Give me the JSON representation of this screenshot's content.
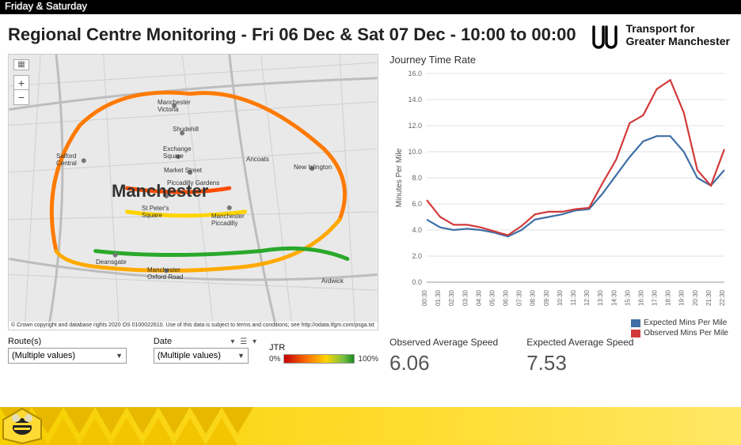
{
  "topbar": {
    "label": "Friday & Saturday"
  },
  "header": {
    "title": "Regional Centre Monitoring - Fri 06 Dec & Sat 07 Dec - 10:00 to 00:00",
    "logo_line1": "Transport for",
    "logo_line2": "Greater Manchester"
  },
  "map": {
    "city_label": "Manchester",
    "places": [
      "Manchester Victoria",
      "Shudehill",
      "Exchange Square",
      "Market Street",
      "Piccadilly Gardens",
      "St Peter's Square",
      "Deansgate",
      "Manchester Oxford Road",
      "Manchester Piccadilly",
      "New Islington",
      "Ancoats",
      "Salford Central",
      "Ardwick"
    ],
    "credit": "© Crown copyright and database rights 2020 OS 0100022610. Use of this data is subject to terms and conditions; see http://odata.tfgm.com/psga.txt"
  },
  "filters": {
    "routes": {
      "label": "Route(s)",
      "value": "(Multiple values)"
    },
    "date": {
      "label": "Date",
      "value": "(Multiple values)"
    },
    "jtr": {
      "label": "JTR",
      "min": "0%",
      "max": "100%"
    }
  },
  "chart": {
    "title": "Journey Time Rate",
    "ylabel": "Minutes Per Mile",
    "legend": {
      "expected": "Expected Mins Per Mile",
      "observed": "Observed Mins Per Mile"
    }
  },
  "stats": {
    "observed": {
      "label": "Observed Average Speed",
      "value": "6.06"
    },
    "expected": {
      "label": "Expected Average Speed",
      "value": "7.53"
    }
  },
  "chart_data": {
    "type": "line",
    "xlabel": "",
    "ylabel": "Minutes Per Mile",
    "ylim": [
      0,
      16
    ],
    "categories": [
      "00:30",
      "01:30",
      "02:30",
      "03:30",
      "04:30",
      "05:30",
      "06:30",
      "07:30",
      "08:30",
      "09:30",
      "10:30",
      "11:30",
      "12:30",
      "13:30",
      "14:30",
      "15:30",
      "16:30",
      "17:30",
      "18:30",
      "19:30",
      "20:30",
      "21:30",
      "22:30"
    ],
    "series": [
      {
        "name": "Expected Mins Per Mile",
        "color": "#3f6fa6",
        "values": [
          4.8,
          4.2,
          4.0,
          4.1,
          4.0,
          3.8,
          3.5,
          4.0,
          4.8,
          5.0,
          5.2,
          5.5,
          5.6,
          6.8,
          8.2,
          9.6,
          10.8,
          11.2,
          11.2,
          10.0,
          8.0,
          7.4,
          8.6
        ]
      },
      {
        "name": "Observed Mins Per Mile",
        "color": "#d23a3a",
        "values": [
          6.3,
          5.0,
          4.4,
          4.4,
          4.2,
          3.9,
          3.6,
          4.3,
          5.2,
          5.4,
          5.4,
          5.6,
          5.7,
          7.6,
          9.4,
          12.2,
          12.8,
          14.8,
          15.5,
          13.0,
          8.6,
          7.4,
          10.2
        ]
      }
    ]
  }
}
